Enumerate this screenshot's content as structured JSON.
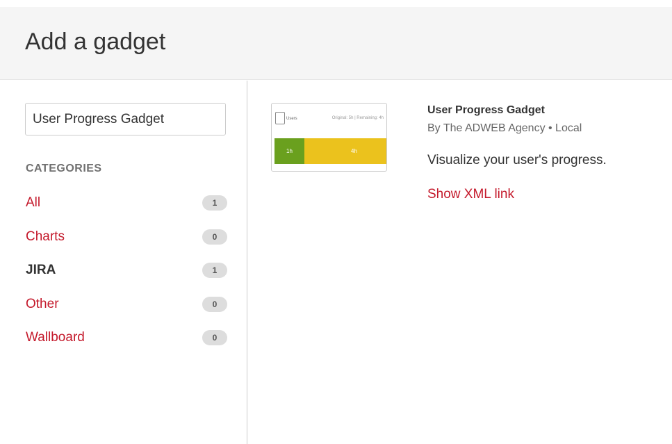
{
  "header": {
    "title": "Add a gadget"
  },
  "sidebar": {
    "search": {
      "value": "User Progress Gadget",
      "placeholder": ""
    },
    "categories_heading": "CATEGORIES",
    "categories": [
      {
        "label": "All",
        "count": "1",
        "active": false
      },
      {
        "label": "Charts",
        "count": "0",
        "active": false
      },
      {
        "label": "JIRA",
        "count": "1",
        "active": true
      },
      {
        "label": "Other",
        "count": "0",
        "active": false
      },
      {
        "label": "Wallboard",
        "count": "0",
        "active": false
      }
    ]
  },
  "gadget": {
    "title": "User Progress Gadget",
    "author": "By The ADWEB Agency • Local",
    "description": "Visualize your user's progress.",
    "xml_link": "Show XML link",
    "thumbnail": {
      "name": "Users",
      "status": "Original: 5h | Remaining: 4h",
      "done_label": "1h",
      "remaining_label": "4h"
    }
  },
  "colors": {
    "link": "#c4192b",
    "header_bg": "#f5f5f5",
    "badge_bg": "#dddddd",
    "progress_done": "#6aa01e",
    "progress_remaining": "#ebc21d"
  }
}
